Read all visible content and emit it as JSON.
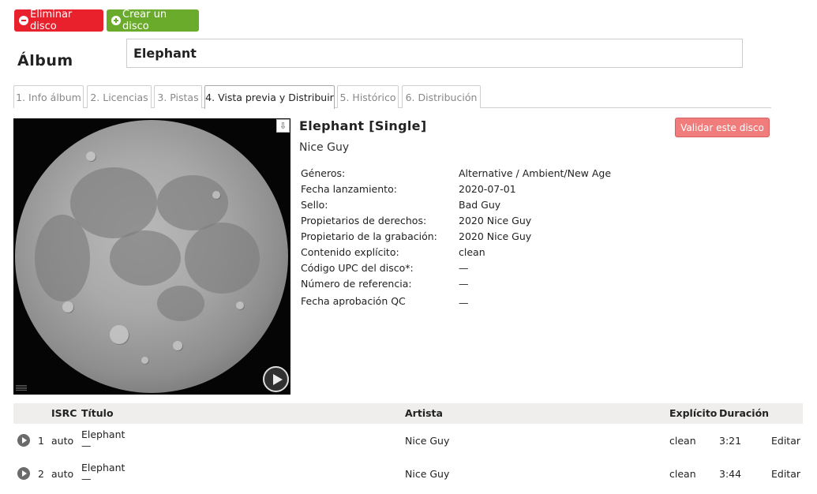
{
  "toolbar": {
    "delete_label": "Eliminar disco",
    "create_label": "Crear un disco"
  },
  "album": {
    "label": "Álbum",
    "name": "Elephant"
  },
  "tabs": [
    {
      "label": "1. Info álbum"
    },
    {
      "label": "2. Licencias"
    },
    {
      "label": "3. Pistas"
    },
    {
      "label": "4. Vista previa y Distribuir",
      "active": true
    },
    {
      "label": "5. Histórico"
    },
    {
      "label": "6. Distribución"
    }
  ],
  "release": {
    "title": "Elephant [Single]",
    "artist": "Nice Guy",
    "validate_label": "Validar este disco",
    "fields": [
      {
        "label": "Géneros:",
        "value": "Alternative / Ambient/New Age"
      },
      {
        "label": "Fecha lanzamiento:",
        "value": "2020-07-01"
      },
      {
        "label": "Sello:",
        "value": "Bad Guy"
      },
      {
        "label": "Propietarios de derechos:",
        "value": "2020 Nice Guy"
      },
      {
        "label": "Propietario de la grabación:",
        "value": "2020 Nice Guy"
      },
      {
        "label": "Contenido explícito:",
        "value": "clean"
      },
      {
        "label": "Código UPC del disco*:",
        "value": "—"
      },
      {
        "label": "Número de referencia:",
        "value": "—"
      },
      {
        "label": "Fecha aprobación QC",
        "value": "—"
      }
    ]
  },
  "icons": {
    "download": "download-icon",
    "play": "play-icon",
    "delete": "minus-circle-icon",
    "create": "plus-circle-icon"
  },
  "colors": {
    "delete_button": "#e8212c",
    "create_button": "#6aab2b",
    "validate_button": "#f07c7c",
    "table_header": "#efeeec"
  },
  "tracks": {
    "headers": {
      "isrc": "ISRC",
      "title": "Título",
      "artist": "Artista",
      "explicit": "Explícito",
      "duration": "Duración"
    },
    "rows": [
      {
        "num": "1",
        "isrc": "auto",
        "title": "Elephant",
        "subtitle": "—",
        "artist": "Nice Guy",
        "explicit": "clean",
        "duration": "3:21",
        "action": "Editar"
      },
      {
        "num": "2",
        "isrc": "auto",
        "title": "Elephant",
        "subtitle": "—",
        "artist": "Nice Guy",
        "explicit": "clean",
        "duration": "3:44",
        "action": "Editar"
      }
    ]
  }
}
